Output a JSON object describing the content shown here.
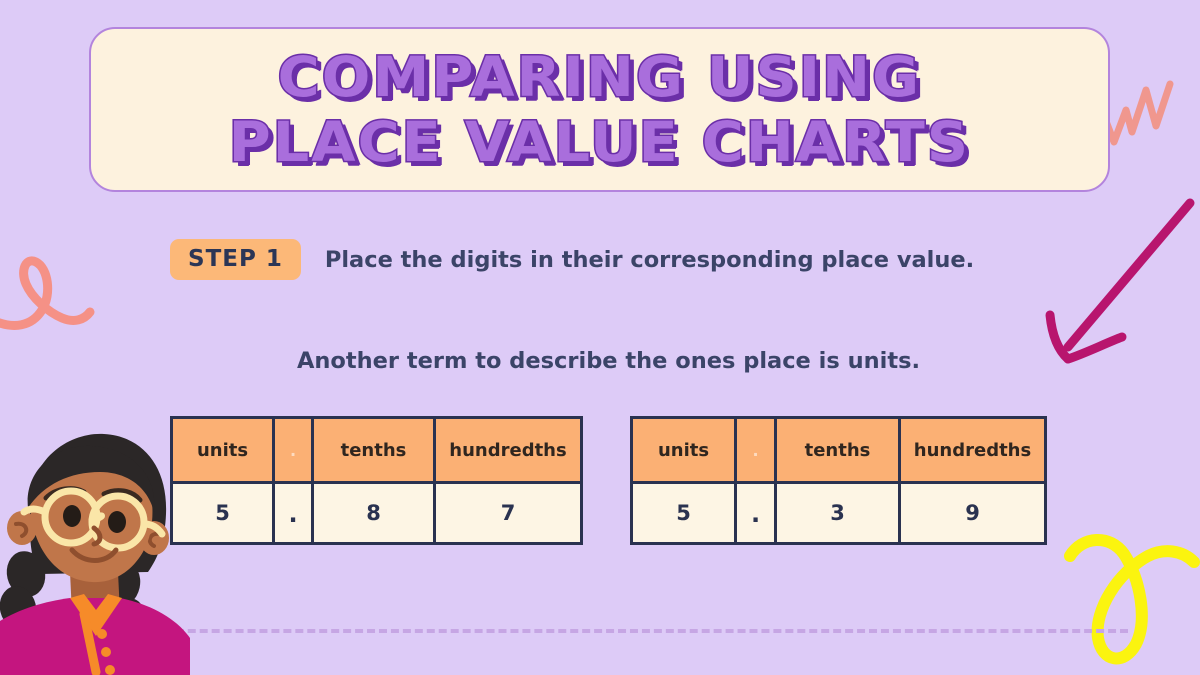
{
  "slide": {
    "background_color": "#ddcbf7",
    "title_lines": [
      "Comparing Using",
      "Place Value Charts"
    ],
    "title_color": "#a96edc",
    "title_outline_color": "#6b2fa8",
    "card_color": "#fdf2de",
    "card_border_color": "#b384dd"
  },
  "step": {
    "badge_label": "Step 1",
    "badge_color": "#fcb878",
    "instruction": "Place the digits in their corresponding place value."
  },
  "subtitle": "Another term to describe the ones place is units.",
  "charts": [
    {
      "name": "left-place-value-chart",
      "headers": [
        "units",
        ".",
        "tenths",
        "hundredths"
      ],
      "values": [
        "5",
        ".",
        "8",
        "7"
      ],
      "number": "5.87",
      "header_color": "#fbb074",
      "cell_color": "#fdf5e4",
      "border_color": "#2a3250"
    },
    {
      "name": "right-place-value-chart",
      "headers": [
        "units",
        ".",
        "tenths",
        "hundredths"
      ],
      "values": [
        "5",
        ".",
        "3",
        "9"
      ],
      "number": "5.39",
      "header_color": "#fbb074",
      "cell_color": "#fdf5e4",
      "border_color": "#2a3250"
    }
  ],
  "decorations": {
    "coral_loop_left": "coral-cursive-loop-doodle",
    "coral_zigzag_right": "coral-zigzag-doodle",
    "magenta_arrow": "magenta-arrow-doodle",
    "yellow_loop": "yellow-loop-doodle",
    "dashed_divider": "dashed-purple-line",
    "colors": {
      "coral": "#f59186",
      "magenta": "#b8156e",
      "yellow": "#fbf40f",
      "dash": "#c6a6e4"
    }
  },
  "character": {
    "name": "girl-with-glasses-illustration",
    "skin": "#c0764a",
    "hair": "#2b2727",
    "glasses": "#fae6a8",
    "shirt": "#c4157f",
    "collar": "#f68b29"
  }
}
